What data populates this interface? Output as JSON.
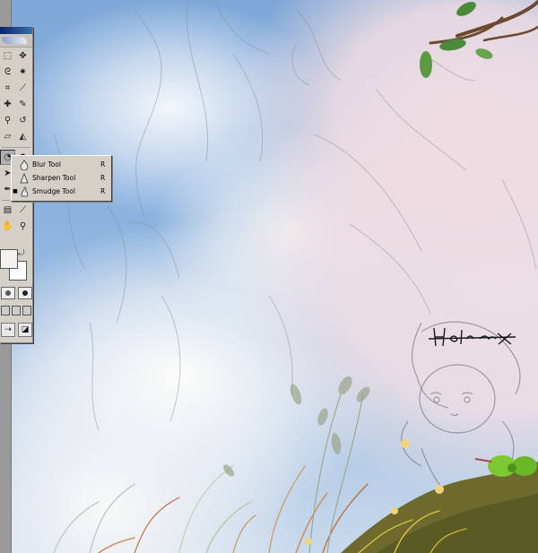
{
  "flyout": {
    "items": [
      {
        "label": "Blur Tool",
        "shortcut": "R",
        "icon": "blur-drop-icon",
        "selected": false
      },
      {
        "label": "Sharpen Tool",
        "shortcut": "R",
        "icon": "sharpen-triangle-icon",
        "selected": false
      },
      {
        "label": "Smudge Tool",
        "shortcut": "R",
        "icon": "smudge-finger-icon",
        "selected": true
      }
    ]
  },
  "toolbox": {
    "tools": [
      "marquee-tool-icon",
      "move-tool-icon",
      "lasso-tool-icon",
      "magic-wand-tool-icon",
      "crop-tool-icon",
      "slice-tool-icon",
      "healing-brush-tool-icon",
      "brush-tool-icon",
      "clone-stamp-tool-icon",
      "history-brush-tool-icon",
      "eraser-tool-icon",
      "paint-bucket-tool-icon",
      "blur-tool-icon",
      "dodge-tool-icon",
      "path-selection-tool-icon",
      "type-tool-icon",
      "pen-tool-icon",
      "shape-tool-icon",
      "notes-tool-icon",
      "eyedropper-tool-icon",
      "hand-tool-icon",
      "zoom-tool-icon"
    ],
    "active_tool": "blur-tool-icon",
    "foreground_color": "#f4f2ee",
    "background_color": "#ffffff"
  },
  "artwork": {
    "signature": "Hulee"
  }
}
